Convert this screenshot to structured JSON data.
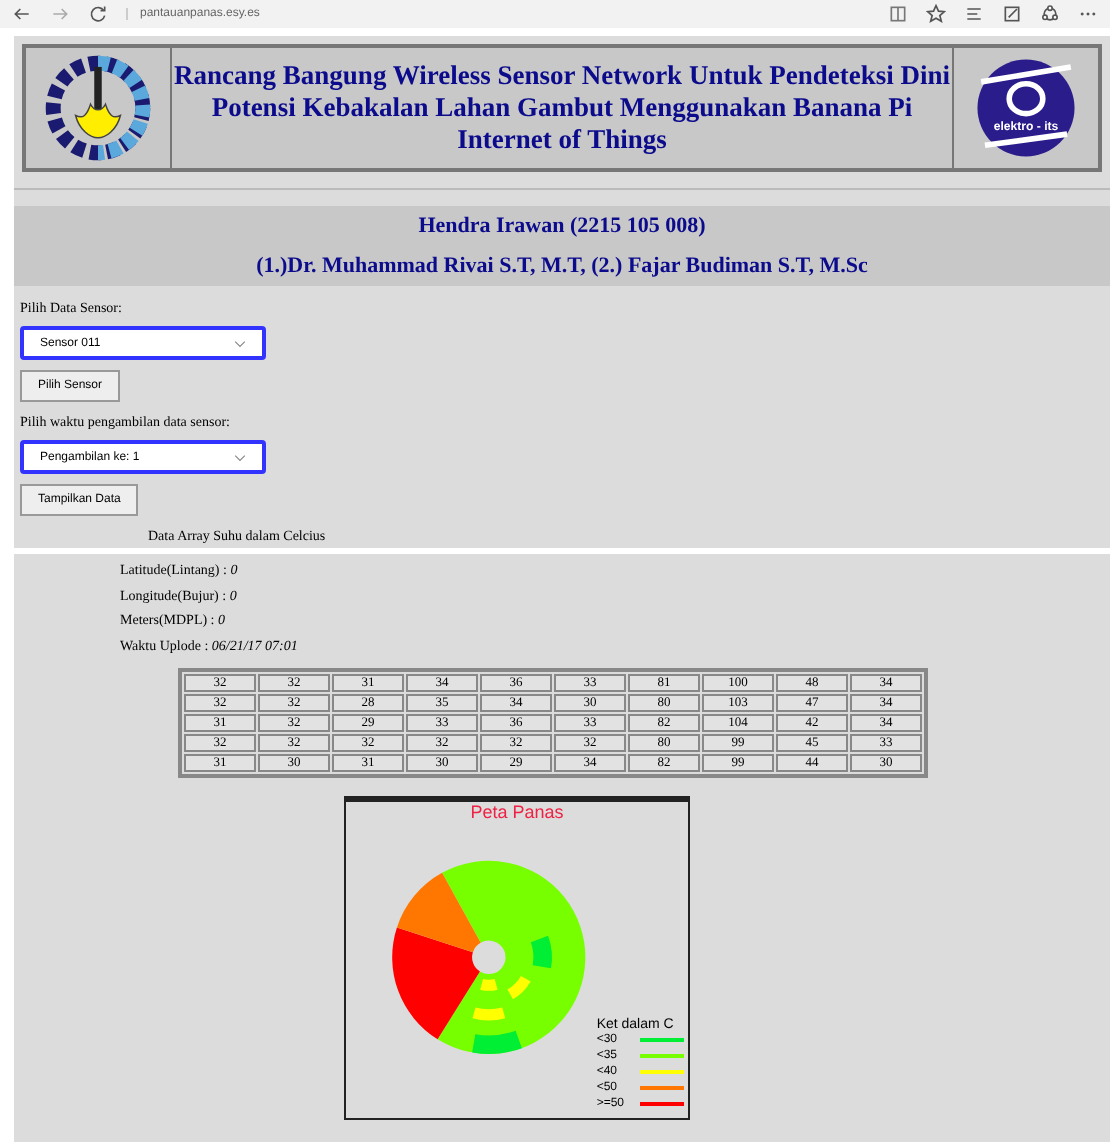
{
  "browser": {
    "url": "pantauanpanas.esy.es"
  },
  "header": {
    "title": "Rancang Bangung Wireless Sensor Network Untuk Pendeteksi Dini Potensi Kebakalan Lahan Gambut Menggunakan Banana Pi Internet of Things",
    "right_logo_text": "elektro - its"
  },
  "author": "Hendra Irawan (2215 105 008)",
  "supervisors": "(1.)Dr. Muhammad Rivai S.T, M.T, (2.) Fajar Budiman S.T, M.Sc",
  "sensor_select": {
    "label": "Pilih Data Sensor:",
    "value": "Sensor 011",
    "button": "Pilih Sensor"
  },
  "time_select": {
    "label": "Pilih waktu pengambilan data sensor:",
    "value": "Pengambilan ke: 1",
    "button": "Tampilkan Data"
  },
  "array_caption": "Data Array Suhu dalam Celcius",
  "info": [
    {
      "label": "Latitude(Lintang) : ",
      "value": "0"
    },
    {
      "label": "Longitude(Bujur) : ",
      "value": "0"
    },
    {
      "label": "Meters(MDPL) : ",
      "value": "0"
    },
    {
      "label": "Waktu Uplode : ",
      "value": "06/21/17 07:01"
    }
  ],
  "table": {
    "rows": [
      [
        "32",
        "32",
        "31",
        "34",
        "36",
        "33",
        "81",
        "100",
        "48",
        "34"
      ],
      [
        "32",
        "32",
        "28",
        "35",
        "34",
        "30",
        "80",
        "103",
        "47",
        "34"
      ],
      [
        "31",
        "32",
        "29",
        "33",
        "36",
        "33",
        "82",
        "104",
        "42",
        "34"
      ],
      [
        "32",
        "32",
        "32",
        "32",
        "32",
        "32",
        "80",
        "99",
        "45",
        "33"
      ],
      [
        "31",
        "30",
        "31",
        "30",
        "29",
        "34",
        "82",
        "99",
        "44",
        "30"
      ]
    ]
  },
  "heatmap": {
    "title": "Peta Panas",
    "legend_title": "Ket dalam C",
    "legend": [
      {
        "label": "<30",
        "color": "#00ee33"
      },
      {
        "label": "<35",
        "color": "#77ff00"
      },
      {
        "label": "<40",
        "color": "#ffff00"
      },
      {
        "label": "<50",
        "color": "#ff7700"
      },
      {
        "label": ">=50",
        "color": "#ff0000"
      }
    ]
  }
}
